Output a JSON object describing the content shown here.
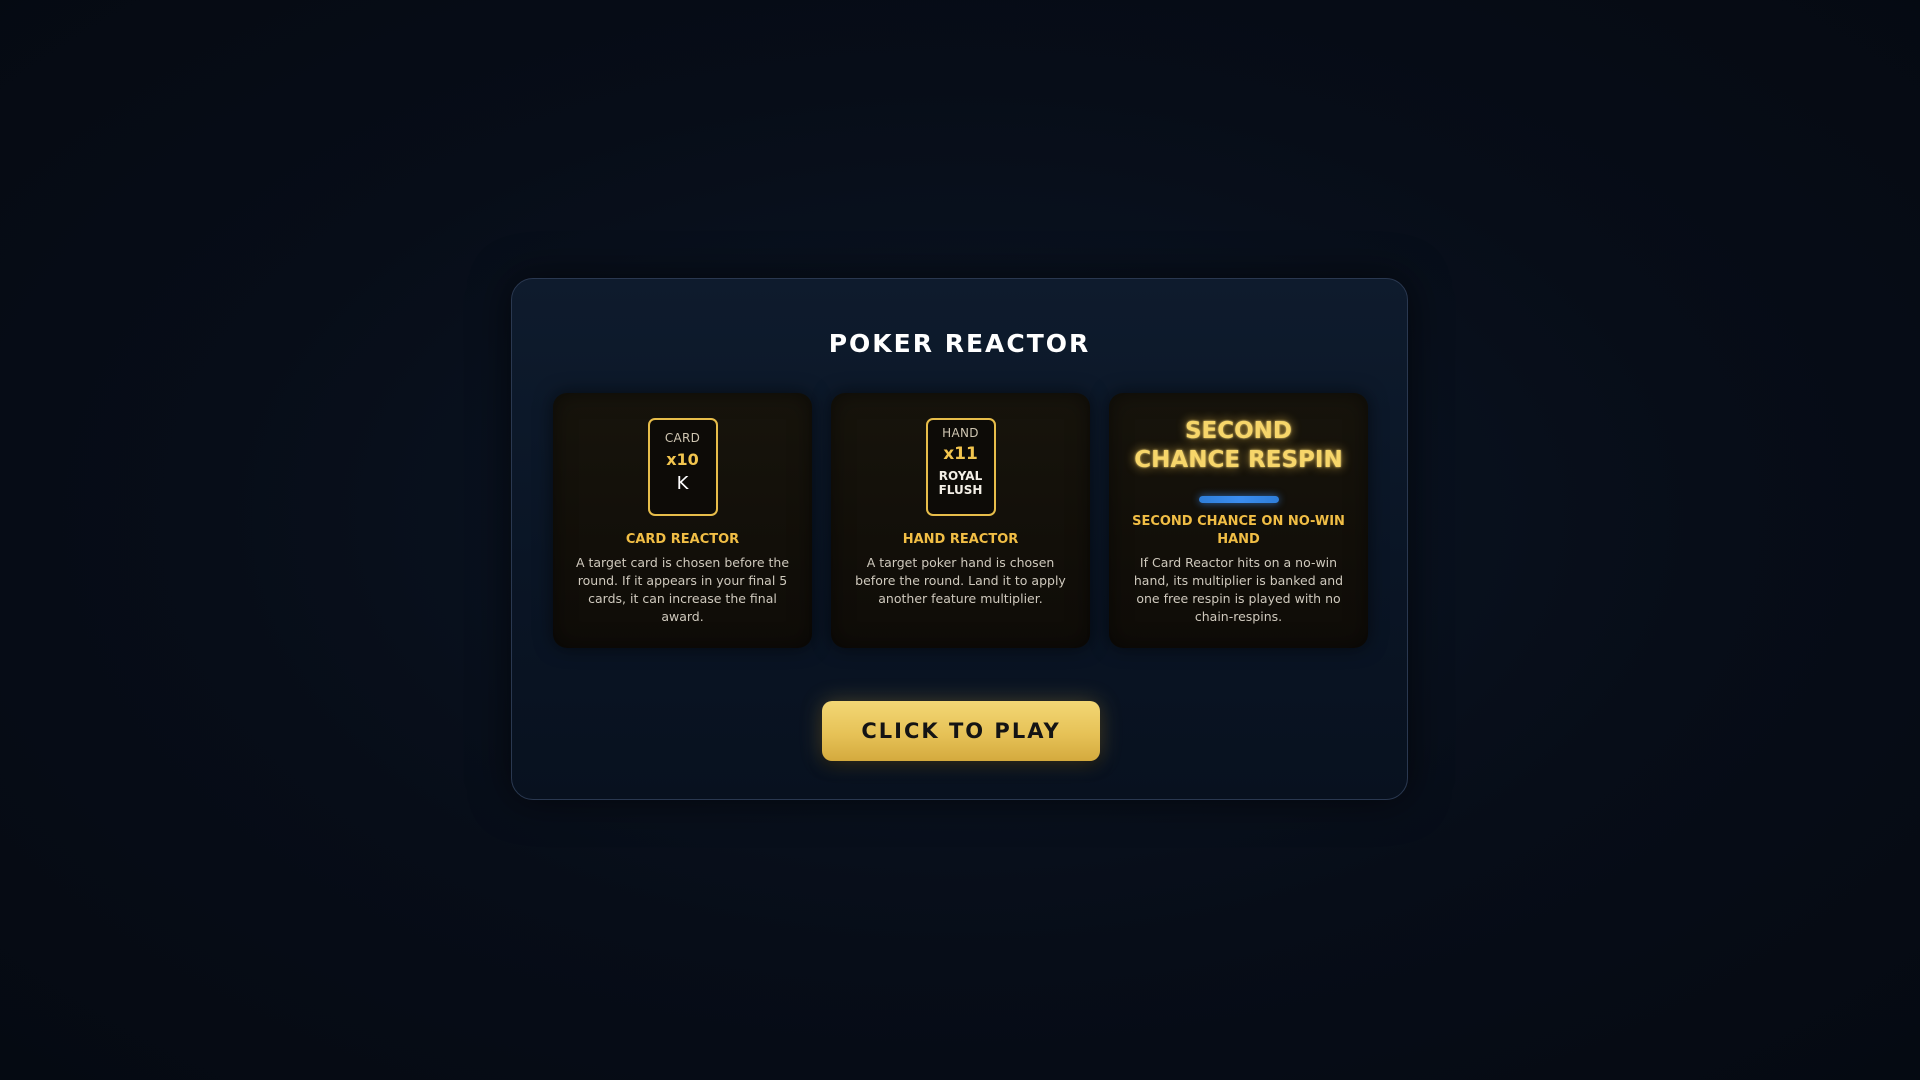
{
  "modal": {
    "title": "POKER REACTOR",
    "play_button_label": "CLICK TO PLAY"
  },
  "cards": [
    {
      "mini_label": "CARD",
      "multiplier": "x10",
      "value": "K",
      "heading": "CARD REACTOR",
      "description": "A target card is chosen before the round. If it appears in your final 5 cards, it can increase the final award."
    },
    {
      "mini_label": "HAND",
      "multiplier": "x11",
      "value_line1": "ROYAL",
      "value_line2": "FLUSH",
      "heading": "HAND REACTOR",
      "description": "A target poker hand is chosen before the round. Land it to apply another feature multiplier."
    },
    {
      "title_line1": "SECOND",
      "title_line2": "CHANCE RESPIN",
      "heading": "SECOND CHANCE ON NO-WIN HAND",
      "description": "If Card Reactor hits on a no-win hand, its multiplier is banked and one free respin is played with no chain-respins."
    }
  ],
  "colors": {
    "accent_gold": "#f1be45",
    "respin_bar": "#3b8df0",
    "background": "#060c16"
  }
}
